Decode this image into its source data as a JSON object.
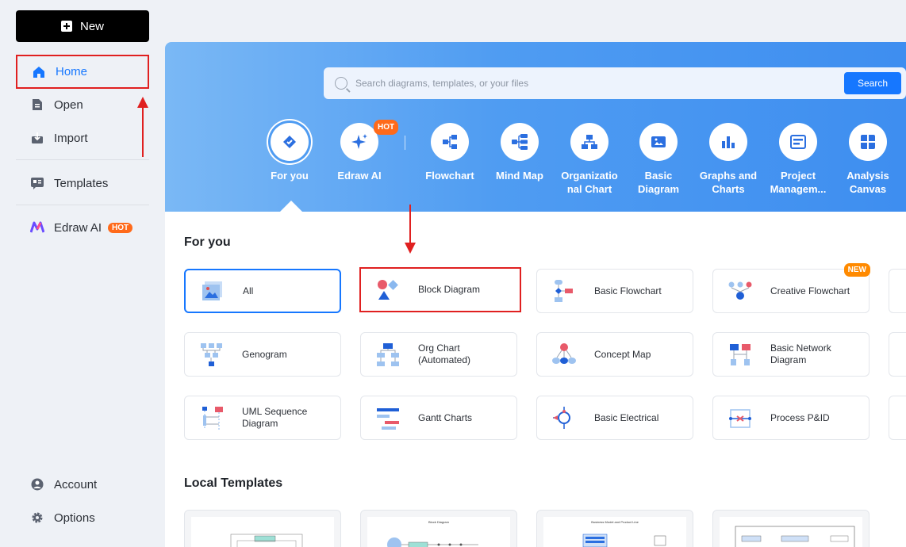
{
  "sidebar": {
    "new_label": "New",
    "items": [
      {
        "label": "Home"
      },
      {
        "label": "Open"
      },
      {
        "label": "Import"
      },
      {
        "label": "Templates"
      },
      {
        "label": "Edraw AI",
        "badge": "HOT"
      },
      {
        "label": "Account"
      },
      {
        "label": "Options"
      }
    ]
  },
  "search": {
    "placeholder": "Search diagrams, templates, or your files",
    "button": "Search"
  },
  "categories": [
    {
      "label": "For you",
      "icon": "for-you-icon",
      "active": true
    },
    {
      "label": "Edraw AI",
      "icon": "sparkle-icon",
      "badge": "HOT"
    },
    {
      "label": "Flowchart",
      "icon": "flowchart-icon"
    },
    {
      "label": "Mind Map",
      "icon": "mind-map-icon"
    },
    {
      "label": "Organizatio nal Chart",
      "icon": "org-chart-icon"
    },
    {
      "label": "Basic Diagram",
      "icon": "basic-diagram-icon"
    },
    {
      "label": "Graphs and Charts",
      "icon": "bar-chart-icon"
    },
    {
      "label": "Project Managem...",
      "icon": "project-icon"
    },
    {
      "label": "Analysis Canvas",
      "icon": "grid-icon"
    }
  ],
  "for_you": {
    "title": "For you",
    "cards": [
      {
        "label": "All"
      },
      {
        "label": "Block Diagram"
      },
      {
        "label": "Basic Flowchart"
      },
      {
        "label": "Creative Flowchart",
        "badge": "NEW"
      },
      {
        "label": "Genogram"
      },
      {
        "label": "Org Chart (Automated)"
      },
      {
        "label": "Concept Map"
      },
      {
        "label": "Basic Network Diagram"
      },
      {
        "label": "UML Sequence Diagram"
      },
      {
        "label": "Gantt Charts"
      },
      {
        "label": "Basic Electrical"
      },
      {
        "label": "Process P&ID"
      }
    ]
  },
  "local_templates": {
    "title": "Local Templates",
    "thumbs": [
      "",
      "Block Diagram",
      "Business Model and Product Line",
      ""
    ]
  },
  "colors": {
    "accent": "#1677ff",
    "annotation_red": "#e02020",
    "hot": "#ff6a1a",
    "banner_start": "#7ab8f5",
    "banner_end": "#3e8ef0"
  }
}
